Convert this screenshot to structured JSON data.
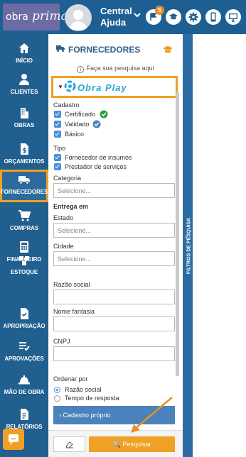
{
  "header": {
    "logo_part1": "obra",
    "logo_part2": "prima",
    "user_name": "Central Ajuda",
    "notification_count": "5",
    "icons": [
      "flag-icon",
      "graduation-cap-icon",
      "gear-icon",
      "mobile-icon",
      "monitor-icon"
    ]
  },
  "sidebar": {
    "items": [
      {
        "label": "INÍCIO",
        "icon": "home-icon"
      },
      {
        "label": "CLIENTES",
        "icon": "user-icon"
      },
      {
        "label": "OBRAS",
        "icon": "building-icon"
      },
      {
        "label": "ORÇAMENTOS",
        "icon": "dollar-document-icon"
      },
      {
        "label": "FORNECEDORES",
        "icon": "truck-icon"
      },
      {
        "label": "COMPRAS",
        "icon": "cart-icon"
      },
      {
        "label": "FINANCEIRO",
        "icon": "calculator-icon"
      },
      {
        "label": "ESTOQUE",
        "icon": "boxes-icon"
      },
      {
        "label": "APROPRIAÇÃO",
        "icon": "document-check-icon"
      },
      {
        "label": "APROVAÇÕES",
        "icon": "list-check-icon"
      },
      {
        "label": "MÃO DE OBRA",
        "icon": "helmet-icon"
      },
      {
        "label": "RELATÓRIOS",
        "icon": "report-icon"
      }
    ],
    "active": "FORNECEDORES"
  },
  "panel": {
    "title": "FORNECEDORES",
    "hint": "Faça sua pesquisa aqui",
    "brand": "Obra Play",
    "cadastro_label": "Cadastro",
    "cadastro_options": [
      "Certificado",
      "Validado",
      "Básico"
    ],
    "tipo_label": "Tipo",
    "tipo_options": [
      "Fornecedor de insumos",
      "Prestador de serviços"
    ],
    "categoria_label": "Categoria",
    "select_placeholder": "Selecione...",
    "entrega_label": "Entrega em",
    "estado_label": "Estado",
    "cidade_label": "Cidade",
    "razao_label": "Razão social",
    "fantasia_label": "Nome fantasia",
    "cnpj_label": "CNPJ",
    "ordenar_label": "Ordenar por",
    "ordenar_options": [
      "Razão social",
      "Tempo de resposta"
    ],
    "ordenar_selected": "Razão social",
    "accordion": "Cadastro próprio",
    "search_button": "Pesquisar"
  },
  "side_tab": {
    "label": "FILTROS DE PESQUISA"
  },
  "colors": {
    "header": "#1d5f92",
    "sidebar": "#215f8f",
    "accent": "#f0a024",
    "title": "#2a5d8a",
    "accordion": "#4a82bb"
  }
}
